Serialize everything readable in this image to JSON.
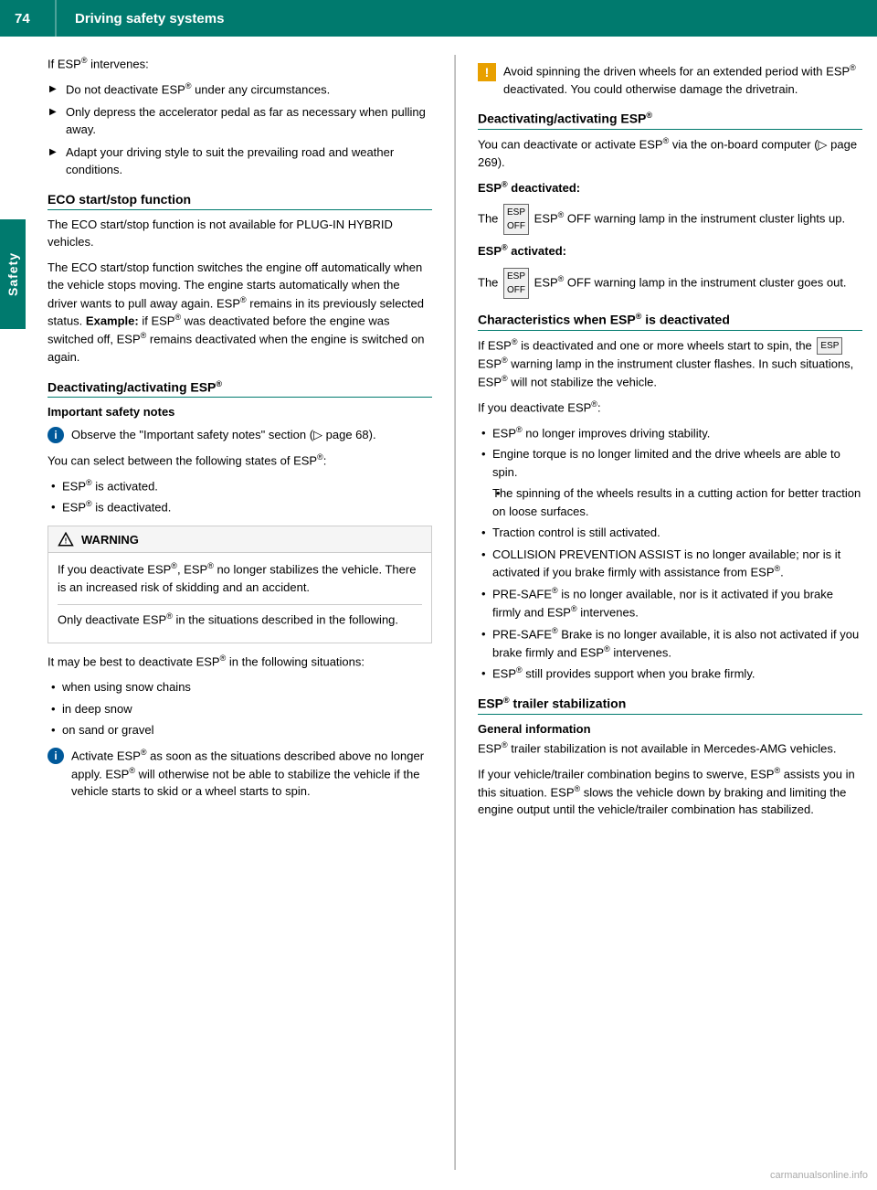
{
  "header": {
    "page_number": "74",
    "title": "Driving safety systems"
  },
  "side_tab": "Safety",
  "left_col": {
    "intro": {
      "text": "If ESP® intervenes:"
    },
    "arrow_items": [
      "Do not deactivate ESP® under any circumstances.",
      "Only depress the accelerator pedal as far as necessary when pulling away.",
      "Adapt your driving style to suit the prevailing road and weather conditions."
    ],
    "eco_section": {
      "heading": "ECO start/stop function",
      "para1": "The ECO start/stop function is not available for PLUG-IN HYBRID vehicles.",
      "para2": "The ECO start/stop function switches the engine off automatically when the vehicle stops moving. The engine starts automatically when the driver wants to pull away again. ESP® remains in its previously selected status.",
      "example_bold": "Example:",
      "example_rest": " if ESP® was deactivated before the engine was switched off, ESP® remains deactivated when the engine is switched on again."
    },
    "deact_section": {
      "heading": "Deactivating/activating ESP®",
      "sub_heading": "Important safety notes",
      "info_text": "Observe the \"Important safety notes\" section (▷ page 68).",
      "para1": "You can select between the following states of ESP®:",
      "bullet_items": [
        "ESP® is activated.",
        "ESP® is deactivated."
      ],
      "warning_header": "WARNING",
      "warning_para1": "If you deactivate ESP®, ESP® no longer stabilizes the vehicle. There is an increased risk of skidding and an accident.",
      "warning_para2": "Only deactivate ESP® in the situations described in the following.",
      "para2": "It may be best to deactivate ESP® in the following situations:",
      "situation_items": [
        "when using snow chains",
        "in deep snow",
        "on sand or gravel"
      ],
      "info2_text": "Activate ESP® as soon as the situations described above no longer apply. ESP® will otherwise not be able to stabilize the vehicle if the vehicle starts to skid or a wheel starts to spin."
    }
  },
  "right_col": {
    "caution_text": "Avoid spinning the driven wheels for an extended period with ESP® deactivated. You could otherwise damage the drivetrain.",
    "deact_section": {
      "heading": "Deactivating/activating ESP®",
      "para1": "You can deactivate or activate ESP® via the on-board computer (▷ page 269).",
      "sub1": "ESP® deactivated:",
      "sub1_text": "The ESP® OFF warning lamp in the instrument cluster lights up.",
      "sub2": "ESP® activated:",
      "sub2_text": "The ESP® OFF warning lamp in the instrument cluster goes out."
    },
    "characteristics_section": {
      "heading": "Characteristics when ESP® is deactivated",
      "para1": "If ESP® is deactivated and one or more wheels start to spin, the ESP® warning lamp in the instrument cluster flashes. In such situations, ESP® will not stabilize the vehicle.",
      "para2": "If you deactivate ESP®:",
      "bullet_items": [
        "ESP® no longer improves driving stability.",
        "Engine torque is no longer limited and the drive wheels are able to spin.",
        "The spinning of the wheels results in a cutting action for better traction on loose surfaces.",
        "Traction control is still activated.",
        "COLLISION PREVENTION ASSIST is no longer available; nor is it activated if you brake firmly with assistance from ESP®.",
        "PRE-SAFE® is no longer available, nor is it activated if you brake firmly and ESP® intervenes.",
        "PRE-SAFE® Brake is no longer available, it is also not activated if you brake firmly and ESP® intervenes.",
        "ESP® still provides support when you brake firmly."
      ]
    },
    "trailer_section": {
      "heading": "ESP® trailer stabilization",
      "sub_heading": "General information",
      "para1": "ESP® trailer stabilization is not available in Mercedes-AMG vehicles.",
      "para2": "If your vehicle/trailer combination begins to swerve, ESP® assists you in this situation. ESP® slows the vehicle down by braking and limiting the engine output until the vehicle/trailer combination has stabilized."
    }
  }
}
